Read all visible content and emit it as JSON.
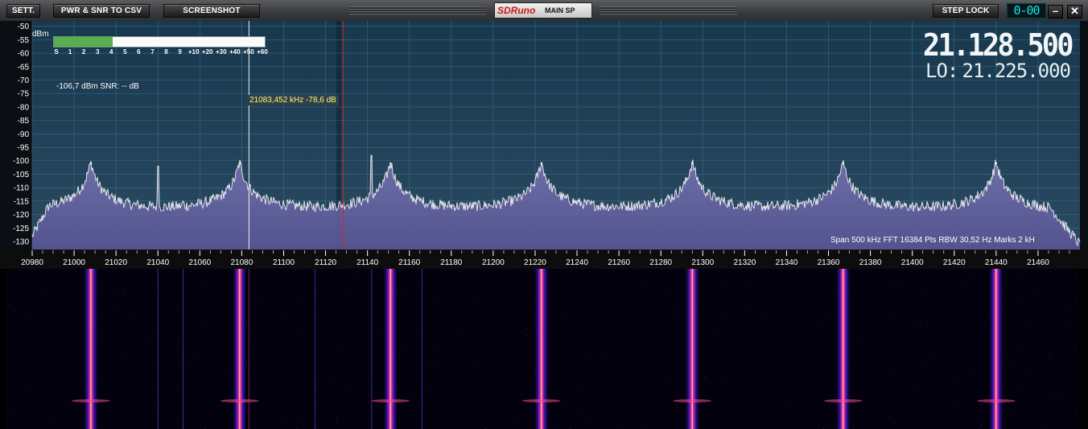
{
  "toolbar": {
    "sett_label": "SETT.",
    "pwr_csv_label": "PWR & SNR TO CSV",
    "screenshot_label": "SCREENSHOT",
    "step_lock_label": "STEP LOCK",
    "step_counter": "0-00",
    "minimize_glyph": "–",
    "close_glyph": "✕"
  },
  "brand": {
    "logo": "SDRuno",
    "window_name": "MAIN SP"
  },
  "display": {
    "frequency": "21.128.500",
    "lo_label": "LO:",
    "lo_frequency": "21.225.000",
    "level_readout": "-106,7 dBm   SNR: -- dB",
    "cursor_readout": "21083,452 kHz -78,6 dB",
    "status_line": "Span 500 kHz   FFT 16384 Pts   RBW 30,52 Hz   Marks 2 kH",
    "y_unit": "dBm"
  },
  "smeter": {
    "level_fraction": 0.28,
    "labels": [
      "S",
      "1",
      "2",
      "3",
      "4",
      "5",
      "6",
      "7",
      "8",
      "9",
      "+10",
      "+20",
      "+30",
      "+40",
      "+50",
      "+60"
    ]
  },
  "colors": {
    "accent": "#1de2e6",
    "brand_red": "#d11818",
    "spectrum_bg": "#1d3f55",
    "meter_fill": "#58b04a",
    "tuned_marker": "#e02020"
  },
  "chart_data": {
    "type": "area",
    "y_ticks": [
      "-50",
      "-55",
      "-60",
      "-65",
      "-70",
      "-75",
      "-80",
      "-85",
      "-90",
      "-95",
      "-100",
      "-105",
      "-110",
      "-115",
      "-120",
      "-125",
      "-130"
    ],
    "x_ticks": [
      "20980",
      "21000",
      "21020",
      "21040",
      "21060",
      "21080",
      "21100",
      "21120",
      "21140",
      "21160",
      "21180",
      "21200",
      "21220",
      "21240",
      "21260",
      "21280",
      "21300",
      "21320",
      "21340",
      "21360",
      "21380",
      "21400",
      "21420",
      "21440",
      "21460"
    ],
    "xlim": [
      20980,
      21480
    ],
    "ylim": [
      -133,
      -48
    ],
    "noise_floor_dbm": -121,
    "peaks": [
      {
        "x": 21008,
        "y": -101
      },
      {
        "x": 21079,
        "y": -101
      },
      {
        "x": 21151,
        "y": -101
      },
      {
        "x": 21223,
        "y": -101
      },
      {
        "x": 21295,
        "y": -101
      },
      {
        "x": 21367,
        "y": -101
      },
      {
        "x": 21440,
        "y": -101
      }
    ],
    "spurs": [
      {
        "x": 21040,
        "y": -102
      },
      {
        "x": 21052,
        "y": -115
      },
      {
        "x": 21142,
        "y": -98
      },
      {
        "x": 21115,
        "y": -120
      },
      {
        "x": 21166,
        "y": -116
      }
    ],
    "cursor_freq": 21083.452,
    "tuned_freq": 21128.5,
    "lo_freq": 21225.0
  }
}
